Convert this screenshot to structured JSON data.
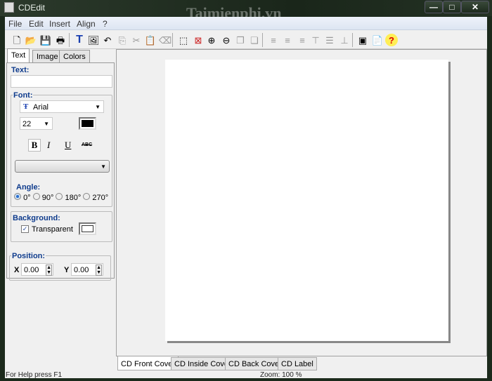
{
  "window": {
    "title": "CDEdit",
    "watermark": "Taimienphi.vn",
    "minimize": "—",
    "maximize": "□",
    "close": "✕"
  },
  "menu": [
    "File",
    "Edit",
    "Insert",
    "Align",
    "?"
  ],
  "toolbar": [
    {
      "name": "new-icon",
      "glyph": "🗋"
    },
    {
      "name": "open-icon",
      "glyph": "📂"
    },
    {
      "name": "save-icon",
      "glyph": "💾"
    },
    {
      "name": "print-icon",
      "glyph": "🖶"
    },
    {
      "name": "insert-text-icon",
      "glyph": "T"
    },
    {
      "name": "insert-image-icon",
      "glyph": "🖼"
    },
    {
      "name": "undo-icon",
      "glyph": "↶"
    },
    {
      "name": "copy-icon",
      "glyph": "⎘"
    },
    {
      "name": "cut-icon",
      "glyph": "✂"
    },
    {
      "name": "paste-icon",
      "glyph": "📋"
    },
    {
      "name": "eraser-icon",
      "glyph": "⌫"
    },
    {
      "name": "select-icon",
      "glyph": "⬚"
    },
    {
      "name": "delete-selection-icon",
      "glyph": "⊠"
    },
    {
      "name": "zoom-in-icon",
      "glyph": "⊕"
    },
    {
      "name": "zoom-out-icon",
      "glyph": "⊖"
    },
    {
      "name": "bring-front-icon",
      "glyph": "❐"
    },
    {
      "name": "send-back-icon",
      "glyph": "❏"
    },
    {
      "name": "align-left-icon",
      "glyph": "≡"
    },
    {
      "name": "align-center-icon",
      "glyph": "≡"
    },
    {
      "name": "align-right-icon",
      "glyph": "≡"
    },
    {
      "name": "align-top-icon",
      "glyph": "⊤"
    },
    {
      "name": "align-middle-icon",
      "glyph": "☰"
    },
    {
      "name": "align-bottom-icon",
      "glyph": "⊥"
    },
    {
      "name": "image-properties-icon",
      "glyph": "▣"
    },
    {
      "name": "wizard-icon",
      "glyph": "📄"
    },
    {
      "name": "help-icon",
      "glyph": "?"
    }
  ],
  "panel": {
    "tabs": [
      "Text",
      "Image",
      "Colors"
    ],
    "text_label": "Text:",
    "text_value": "",
    "font_label": "Font:",
    "font_name": "Arial",
    "font_size": "22",
    "font_color": "#000000",
    "style_buttons": [
      "B",
      "I",
      "U",
      "ABC"
    ],
    "effect_value": "",
    "angle_label": "Angle:",
    "angles": [
      "0°",
      "90°",
      "180°",
      "270°"
    ],
    "angle_selected": "0°",
    "background_label": "Background:",
    "transparent_label": "Transparent",
    "transparent_checked": true,
    "position_label": "Position:",
    "x_label": "X",
    "x_value": "0.00",
    "y_label": "Y",
    "y_value": "0.00"
  },
  "bottom_tabs": [
    "CD Front Cover",
    "CD Inside Cover",
    "CD Back Cover",
    "CD Label"
  ],
  "status": {
    "help": "For Help press F1",
    "zoom": "Zoom: 100 %"
  }
}
